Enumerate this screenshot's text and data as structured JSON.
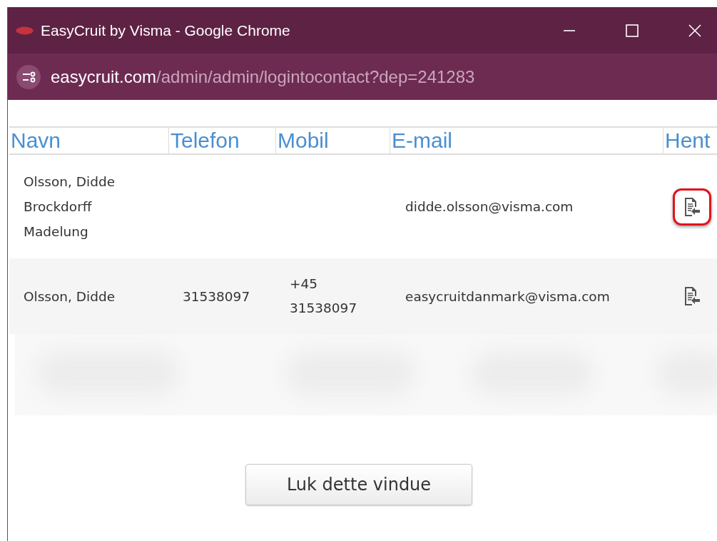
{
  "window": {
    "title": "EasyCruit by Visma - Google Chrome",
    "url_host": "easycruit.com",
    "url_path": "/admin/admin/logintocontact?dep=241283"
  },
  "table": {
    "columns": [
      "Navn",
      "Telefon",
      "Mobil",
      "E-mail",
      "Hent"
    ],
    "rows": [
      {
        "kind": "contact",
        "name": "Olsson, Didde Brockdorff Madelung",
        "phone": "",
        "mobile": "",
        "email": "didde.olsson@visma.com",
        "highlighted": true
      },
      {
        "kind": "contact",
        "name": "Olsson, Didde",
        "phone": "31538097",
        "mobile": "+45 31538097",
        "email": "easycruitdanmark@visma.com",
        "highlighted": false
      },
      {
        "kind": "redacted"
      }
    ]
  },
  "close_button": "Luk dette vindue"
}
